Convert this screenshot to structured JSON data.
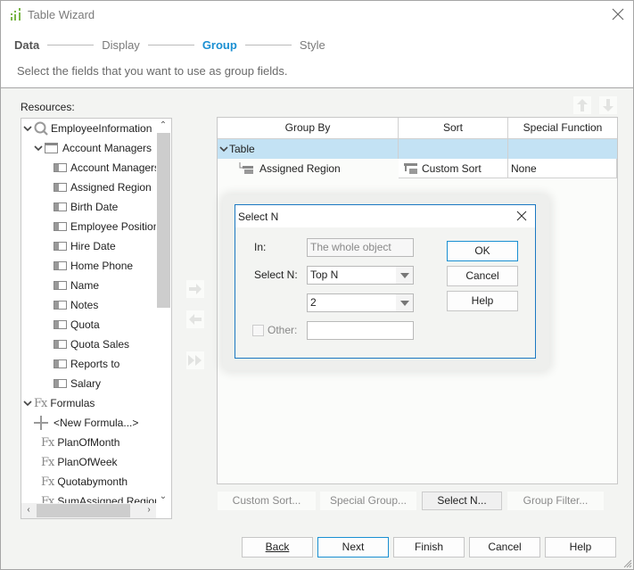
{
  "window": {
    "title": "Table Wizard",
    "accent": "#1a8fd2"
  },
  "steps": [
    {
      "label": "Data",
      "state": "done"
    },
    {
      "label": "Display",
      "state": "pending"
    },
    {
      "label": "Group",
      "state": "active"
    },
    {
      "label": "Style",
      "state": "pending"
    }
  ],
  "instruction": "Select the fields that you want to use as group fields.",
  "resources": {
    "label": "Resources:",
    "tree": [
      {
        "label": "EmployeeInformation",
        "level": 0,
        "icon": "query-icon",
        "expanded": true
      },
      {
        "label": "Account Managers",
        "level": 1,
        "icon": "table-icon",
        "expanded": true
      },
      {
        "label": "Account Managers I",
        "level": 2,
        "icon": "field-icon"
      },
      {
        "label": "Assigned Region",
        "level": 2,
        "icon": "field-icon"
      },
      {
        "label": "Birth Date",
        "level": 2,
        "icon": "field-icon"
      },
      {
        "label": "Employee Position",
        "level": 2,
        "icon": "field-icon"
      },
      {
        "label": "Hire Date",
        "level": 2,
        "icon": "field-icon"
      },
      {
        "label": "Home Phone",
        "level": 2,
        "icon": "field-icon"
      },
      {
        "label": "Name",
        "level": 2,
        "icon": "field-icon"
      },
      {
        "label": "Notes",
        "level": 2,
        "icon": "field-icon"
      },
      {
        "label": "Quota",
        "level": 2,
        "icon": "field-icon"
      },
      {
        "label": "Quota Sales",
        "level": 2,
        "icon": "field-icon"
      },
      {
        "label": "Reports to",
        "level": 2,
        "icon": "field-icon"
      },
      {
        "label": "Salary",
        "level": 2,
        "icon": "field-icon"
      },
      {
        "label": "Formulas",
        "level": 0,
        "icon": "formula-icon",
        "expanded": true
      },
      {
        "label": "<New Formula...>",
        "level": 1,
        "icon": "plus-icon"
      },
      {
        "label": "PlanOfMonth",
        "level": 1,
        "icon": "formula-icon"
      },
      {
        "label": "PlanOfWeek",
        "level": 1,
        "icon": "formula-icon"
      },
      {
        "label": "Quotabymonth",
        "level": 1,
        "icon": "formula-icon"
      },
      {
        "label": "SumAssigned Region",
        "level": 1,
        "icon": "formula-icon"
      }
    ]
  },
  "grid": {
    "columns": [
      "Group By",
      "Sort",
      "Special Function"
    ],
    "rows": [
      {
        "group_by": "Table",
        "sort": "",
        "special": "",
        "type": "parent",
        "selected": true
      },
      {
        "group_by": "Assigned Region",
        "sort": "Custom Sort",
        "special": "None",
        "type": "child"
      }
    ]
  },
  "action_buttons": {
    "custom_sort": "Custom Sort...",
    "special_group": "Special Group...",
    "select_n": "Select N...",
    "group_filter": "Group Filter..."
  },
  "footer": {
    "back": "Back",
    "next": "Next",
    "finish": "Finish",
    "cancel": "Cancel",
    "help": "Help"
  },
  "dialog": {
    "title": "Select N",
    "in_label": "In:",
    "in_value": "The whole object",
    "select_n_label": "Select N:",
    "select_n_value": "Top N",
    "n_value": "2",
    "other_label": "Other:",
    "other_value": "",
    "other_checked": false,
    "ok": "OK",
    "cancel": "Cancel",
    "help": "Help"
  }
}
